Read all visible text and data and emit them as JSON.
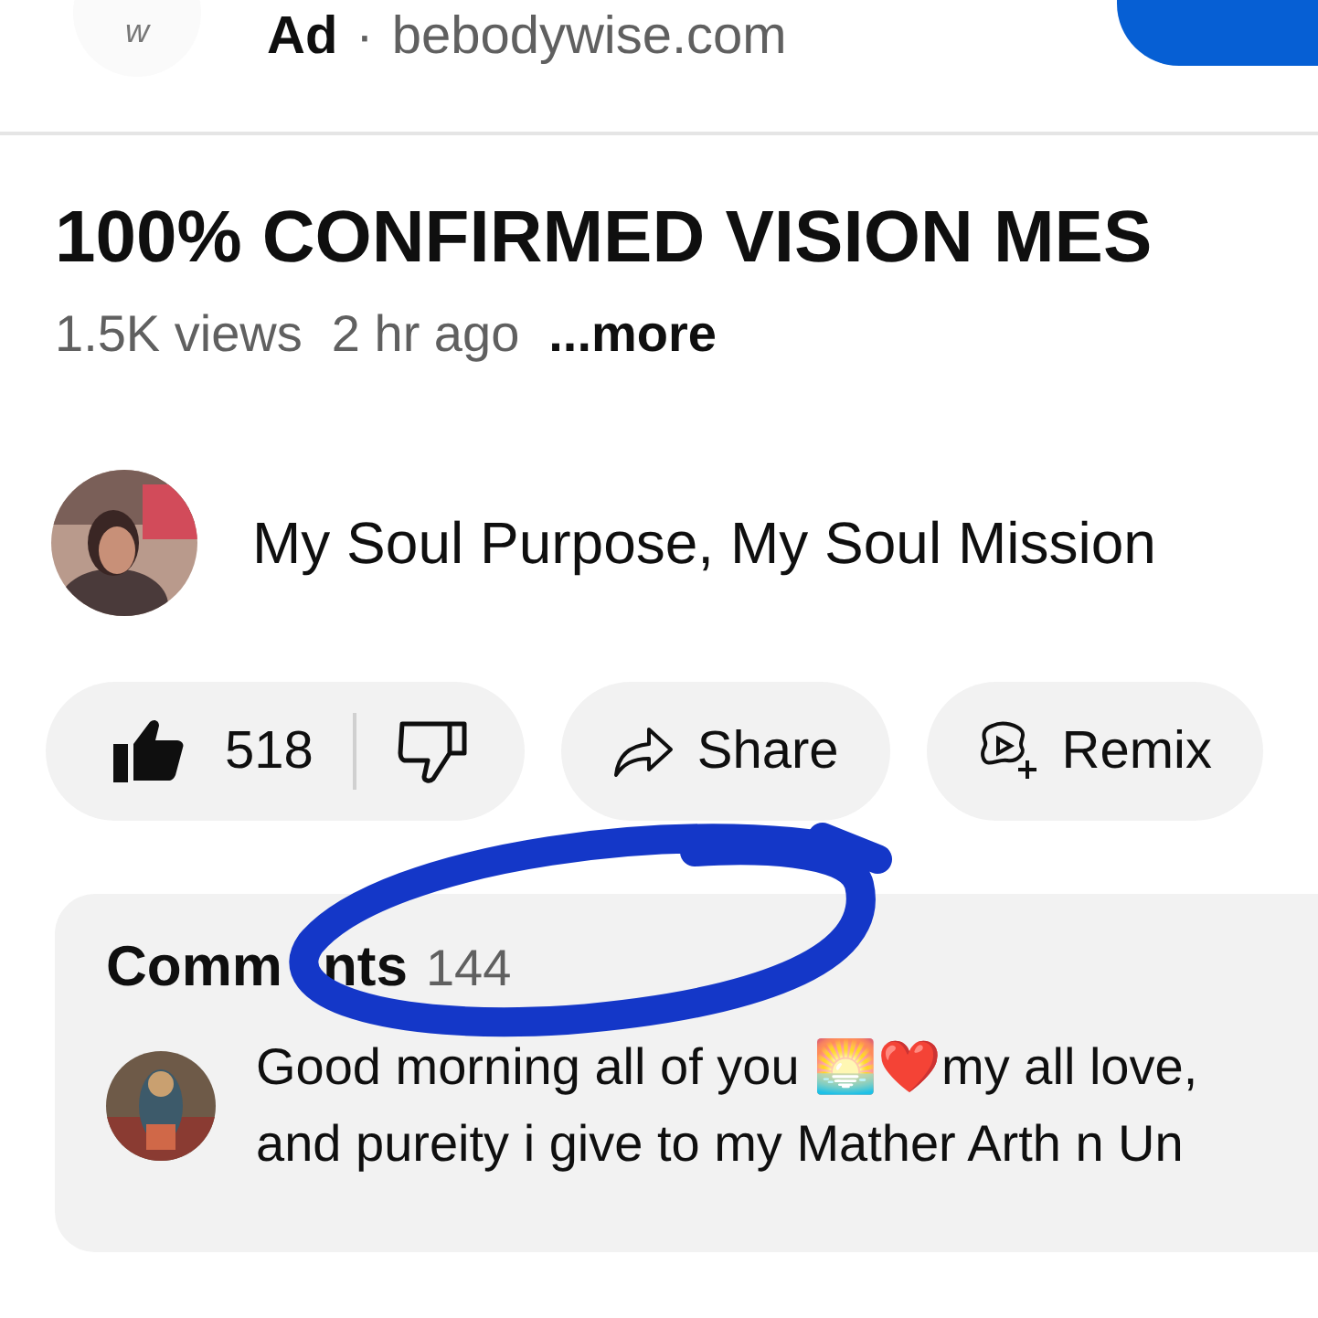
{
  "ad": {
    "label": "Ad",
    "separator": "·",
    "domain": "bebodywise.com",
    "avatar_letter": "w"
  },
  "video": {
    "title": "100% CONFIRMED VISION MES",
    "views": "1.5K views",
    "age": "2 hr ago",
    "more": "...more"
  },
  "channel": {
    "name": "My Soul Purpose, My Soul Mission"
  },
  "actions": [
    {
      "kind": "like",
      "label": "518"
    },
    {
      "kind": "share",
      "label": "Share"
    },
    {
      "kind": "remix",
      "label": "Remix"
    }
  ],
  "comments": {
    "label_parts": [
      "Comm",
      "nts"
    ],
    "count": "144",
    "preview_lines": [
      "Good morning all of you 🌅❤️my all love,",
      "and pureity i give to my Mather Arth n Un"
    ]
  },
  "annotation": {
    "kind": "ellipse"
  }
}
